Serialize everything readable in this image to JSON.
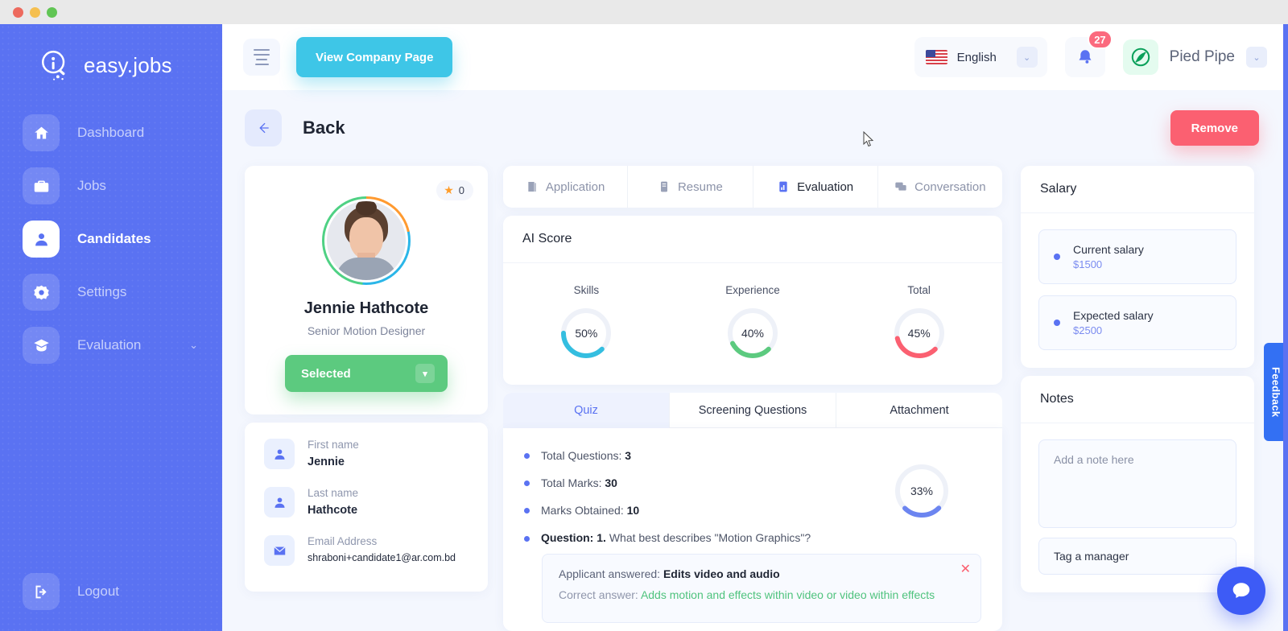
{
  "window": {
    "title": "easy.jobs"
  },
  "sidebar": {
    "brand": "easy.jobs",
    "items": [
      {
        "label": "Dashboard",
        "icon": "home-icon",
        "active": false
      },
      {
        "label": "Jobs",
        "icon": "briefcase-icon",
        "active": false
      },
      {
        "label": "Candidates",
        "icon": "user-icon",
        "active": true
      },
      {
        "label": "Settings",
        "icon": "gear-icon",
        "active": false
      },
      {
        "label": "Evaluation",
        "icon": "graduation-cap-icon",
        "active": false,
        "chevron": "⌄"
      }
    ],
    "logout": {
      "label": "Logout",
      "icon": "logout-icon"
    }
  },
  "topbar": {
    "menu_icon": "hamburger-icon",
    "view_company_label": "View Company Page",
    "language": {
      "value": "English",
      "flag": "us-flag-icon",
      "chevron": "⌄"
    },
    "notifications": {
      "icon": "bell-icon",
      "count": "27"
    },
    "account": {
      "name": "Pied Pipe",
      "logo": "pied-piper-logo",
      "chevron": "⌄"
    }
  },
  "page": {
    "back_label": "Back",
    "remove_label": "Remove"
  },
  "profile": {
    "star_count": "0",
    "name": "Jennie Hathcote",
    "role": "Senior Motion Designer",
    "status": "Selected",
    "fields": [
      {
        "label": "First name",
        "value": "Jennie",
        "icon": "user-icon"
      },
      {
        "label": "Last name",
        "value": "Hathcote",
        "icon": "user-icon"
      },
      {
        "label": "Email Address",
        "value": "shraboni+candidate1@ar.com.bd",
        "icon": "mail-icon"
      }
    ]
  },
  "tabs": [
    {
      "label": "Application",
      "icon": "application-icon",
      "active": false
    },
    {
      "label": "Resume",
      "icon": "resume-icon",
      "active": false
    },
    {
      "label": "Evaluation",
      "icon": "evaluation-icon",
      "active": true
    },
    {
      "label": "Conversation",
      "icon": "conversation-icon",
      "active": false
    }
  ],
  "ai_score": {
    "title": "AI Score"
  },
  "quiz_tabs": [
    {
      "label": "Quiz",
      "active": true
    },
    {
      "label": "Screening Questions",
      "active": false
    },
    {
      "label": "Attachment",
      "active": false
    }
  ],
  "quiz": {
    "stats": [
      {
        "label": "Total Questions:",
        "value": "3"
      },
      {
        "label": "Total Marks:",
        "value": "30"
      },
      {
        "label": "Marks Obtained:",
        "value": "10"
      }
    ],
    "score_percent": "33%",
    "question_prefix": "Question:",
    "question_number": "1.",
    "question_text": "What best describes \"Motion Graphics\"?",
    "applicant_answered_label": "Applicant answered:",
    "applicant_answer": "Edits video and audio",
    "correct_answer_label": "Correct answer:",
    "correct_answer": "Adds motion and effects within video or video within effects",
    "close_icon": "close-icon"
  },
  "salary": {
    "title": "Salary",
    "items": [
      {
        "label": "Current salary",
        "amount": "$1500"
      },
      {
        "label": "Expected salary",
        "amount": "$2500"
      }
    ]
  },
  "notes": {
    "title": "Notes",
    "placeholder": "Add a note here",
    "tag_placeholder": "Tag a manager"
  },
  "feedback": {
    "label": "Feedback"
  },
  "chat": {
    "icon": "chat-bubble-icon"
  },
  "chart_data": [
    {
      "type": "gauge",
      "title": "AI Score",
      "categories": [
        "Skills",
        "Experience",
        "Total"
      ],
      "values": [
        50,
        40,
        45
      ],
      "labels": [
        "50%",
        "40%",
        "45%"
      ],
      "colors": [
        "#34bee0",
        "#5cca7f",
        "#fb6071"
      ],
      "ylim": [
        0,
        100
      ],
      "track_color": "#eef1f8"
    },
    {
      "type": "gauge",
      "title": "Quiz Score",
      "categories": [
        "Quiz"
      ],
      "values": [
        33
      ],
      "labels": [
        "33%"
      ],
      "colors": [
        "#6c85f0"
      ],
      "ylim": [
        0,
        100
      ],
      "track_color": "#eef1f8"
    }
  ]
}
